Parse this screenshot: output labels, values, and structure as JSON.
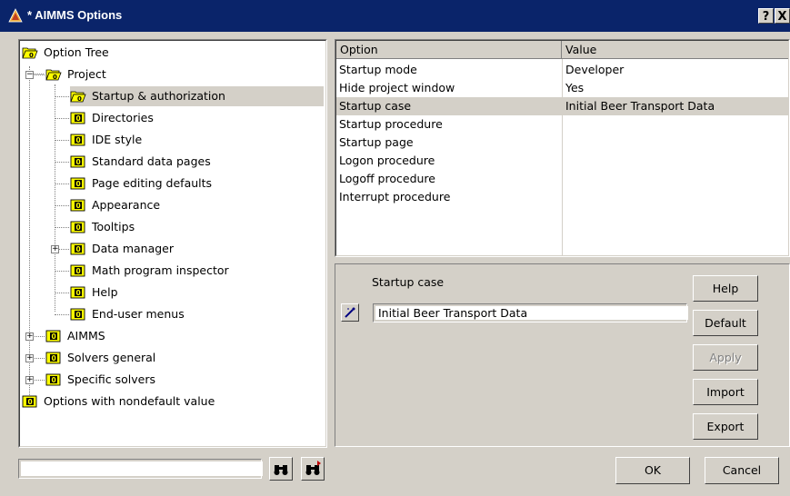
{
  "window": {
    "title": "* AIMMS Options",
    "help_button": "?",
    "close_button": "X"
  },
  "tree": {
    "root": "Option Tree",
    "project": "Project",
    "startup": "Startup & authorization",
    "directories": "Directories",
    "ide_style": "IDE style",
    "standard_data_pages": "Standard data pages",
    "page_editing_defaults": "Page editing defaults",
    "appearance": "Appearance",
    "tooltips": "Tooltips",
    "data_manager": "Data manager",
    "math_program_inspector": "Math program inspector",
    "help": "Help",
    "end_user_menus": "End-user menus",
    "aimms": "AIMMS",
    "solvers_general": "Solvers general",
    "specific_solvers": "Specific solvers",
    "options_nondefault": "Options with nondefault value"
  },
  "grid": {
    "col_option": "Option",
    "col_value": "Value",
    "rows": [
      {
        "option": "Startup mode",
        "value": "Developer"
      },
      {
        "option": "Hide project window",
        "value": "Yes"
      },
      {
        "option": "Startup case",
        "value": "Initial Beer Transport Data"
      },
      {
        "option": "Startup procedure",
        "value": ""
      },
      {
        "option": "Startup page",
        "value": ""
      },
      {
        "option": "Logon procedure",
        "value": ""
      },
      {
        "option": "Logoff procedure",
        "value": ""
      },
      {
        "option": "Interrupt procedure",
        "value": ""
      }
    ]
  },
  "editor": {
    "label": "Startup case",
    "value": "Initial Beer Transport Data"
  },
  "buttons": {
    "help": "Help",
    "default": "Default",
    "apply": "Apply",
    "import": "Import",
    "export": "Export",
    "ok": "OK",
    "cancel": "Cancel"
  },
  "search": {
    "value": ""
  },
  "colors": {
    "titlebar": "#0a246a",
    "face": "#d4d0c8",
    "folder": "#ffff00"
  }
}
